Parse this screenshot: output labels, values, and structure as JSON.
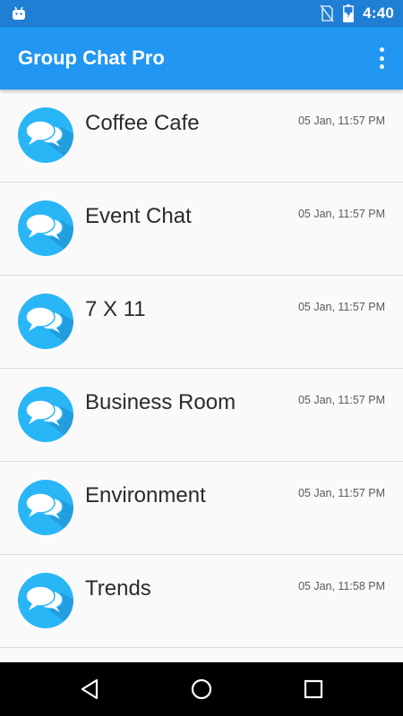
{
  "status_bar": {
    "time": "4:40",
    "icons": [
      "android-icon",
      "no-sim-icon",
      "battery-charging-icon"
    ]
  },
  "app_bar": {
    "title": "Group Chat Pro",
    "menu_icon": "more-vert-icon"
  },
  "chats": [
    {
      "name": "Coffee Cafe",
      "time": "05 Jan, 11:57 PM"
    },
    {
      "name": "Event Chat",
      "time": "05 Jan, 11:57 PM"
    },
    {
      "name": "7 X 11",
      "time": "05 Jan, 11:57 PM"
    },
    {
      "name": "Business Room",
      "time": "05 Jan, 11:57 PM"
    },
    {
      "name": "Environment",
      "time": "05 Jan, 11:57 PM"
    },
    {
      "name": "Trends",
      "time": "05 Jan, 11:58 PM"
    }
  ],
  "nav_bar": {
    "icons": [
      "back-icon",
      "home-icon",
      "recents-icon"
    ]
  },
  "colors": {
    "status_bar": "#1f7fd4",
    "app_bar": "#2196f3",
    "avatar": "#29b6f6",
    "avatar_shadow": "#1e88c8",
    "background": "#fafafa"
  }
}
